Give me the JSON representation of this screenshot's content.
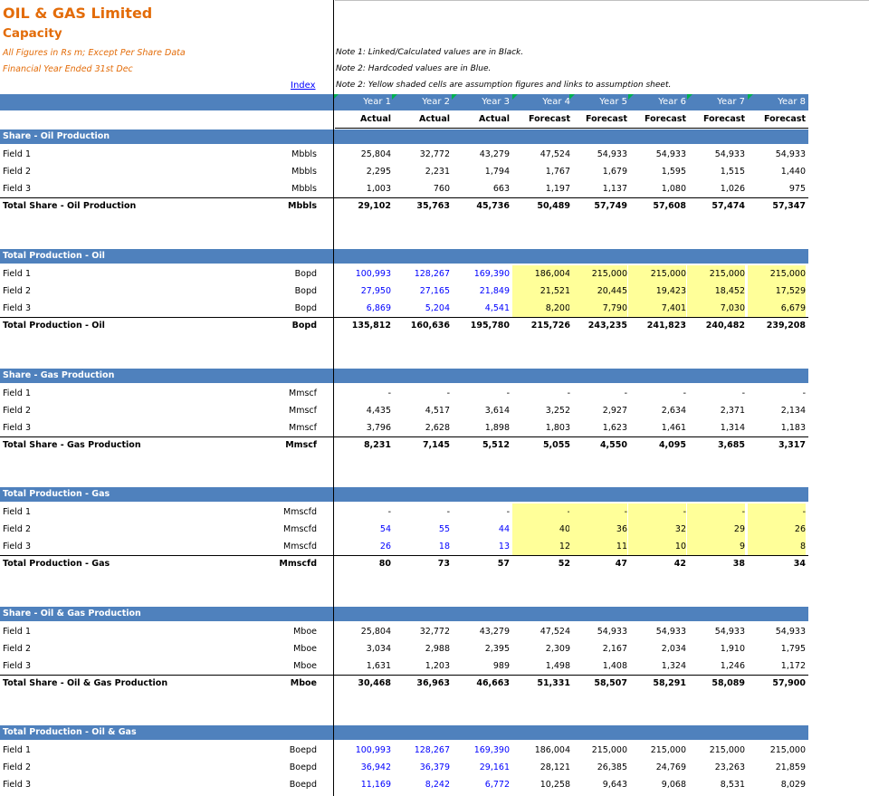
{
  "header": {
    "company": "OIL & GAS Limited",
    "sheet": "Capacity",
    "figures_note": "All Figures in Rs m; Except Per Share Data",
    "fy_note": "Financial Year Ended 31st Dec",
    "index_link": "Index",
    "note1": "Note 1: Linked/Calculated values are in Black.",
    "note2a": "Note 2: Hardcoded values are in Blue.",
    "note2b": "Note 2: Yellow shaded cells are assumption figures and links to assumption sheet.",
    "years": [
      "Year 1",
      "Year 2",
      "Year 3",
      "Year 4",
      "Year 5",
      "Year 6",
      "Year 7",
      "Year 8"
    ],
    "types": [
      "Actual",
      "Actual",
      "Actual",
      "Forecast",
      "Forecast",
      "Forecast",
      "Forecast",
      "Forecast"
    ]
  },
  "colors": {
    "band": "#4f81bd",
    "accent": "#e36c09",
    "input_blue": "#0000ff",
    "assumption_yellow": "#ffff99"
  },
  "sections": [
    {
      "title": "Share - Oil Production",
      "rows": [
        {
          "label": "Field 1",
          "unit": "Mbbls",
          "values": [
            "25,804",
            "32,772",
            "43,279",
            "47,524",
            "54,933",
            "54,933",
            "54,933",
            "54,933"
          ]
        },
        {
          "label": "Field 2",
          "unit": "Mbbls",
          "values": [
            "2,295",
            "2,231",
            "1,794",
            "1,767",
            "1,679",
            "1,595",
            "1,515",
            "1,440"
          ]
        },
        {
          "label": "Field 3",
          "unit": "Mbbls",
          "values": [
            "1,003",
            "760",
            "663",
            "1,197",
            "1,137",
            "1,080",
            "1,026",
            "975"
          ]
        }
      ],
      "total": {
        "label": "Total Share - Oil Production",
        "unit": "Mbbls",
        "values": [
          "29,102",
          "35,763",
          "45,736",
          "50,489",
          "57,749",
          "57,608",
          "57,474",
          "57,347"
        ]
      }
    },
    {
      "title": "Total Production - Oil",
      "rows": [
        {
          "label": "Field 1",
          "unit": "Bopd",
          "values": [
            "100,993",
            "128,267",
            "169,390",
            "186,004",
            "215,000",
            "215,000",
            "215,000",
            "215,000"
          ]
        },
        {
          "label": "Field 2",
          "unit": "Bopd",
          "values": [
            "27,950",
            "27,165",
            "21,849",
            "21,521",
            "20,445",
            "19,423",
            "18,452",
            "17,529"
          ]
        },
        {
          "label": "Field 3",
          "unit": "Bopd",
          "values": [
            "6,869",
            "5,204",
            "4,541",
            "8,200",
            "7,790",
            "7,401",
            "7,030",
            "6,679"
          ]
        }
      ],
      "total": {
        "label": "Total Production - Oil",
        "unit": "Bopd",
        "values": [
          "135,812",
          "160,636",
          "195,780",
          "215,726",
          "243,235",
          "241,823",
          "240,482",
          "239,208"
        ]
      }
    },
    {
      "title": "Share - Gas Production",
      "rows": [
        {
          "label": "Field 1",
          "unit": "Mmscf",
          "values": [
            "-",
            "-",
            "-",
            "-",
            "-",
            "-",
            "-",
            "-"
          ]
        },
        {
          "label": "Field 2",
          "unit": "Mmscf",
          "values": [
            "4,435",
            "4,517",
            "3,614",
            "3,252",
            "2,927",
            "2,634",
            "2,371",
            "2,134"
          ]
        },
        {
          "label": "Field 3",
          "unit": "Mmscf",
          "values": [
            "3,796",
            "2,628",
            "1,898",
            "1,803",
            "1,623",
            "1,461",
            "1,314",
            "1,183"
          ]
        }
      ],
      "total": {
        "label": "Total Share - Gas Production",
        "unit": "Mmscf",
        "values": [
          "8,231",
          "7,145",
          "5,512",
          "5,055",
          "4,550",
          "4,095",
          "3,685",
          "3,317"
        ]
      }
    },
    {
      "title": "Total Production - Gas",
      "rows": [
        {
          "label": "Field 1",
          "unit": "Mmscfd",
          "values": [
            "-",
            "-",
            "-",
            "-",
            "-",
            "-",
            "-",
            "-"
          ]
        },
        {
          "label": "Field 2",
          "unit": "Mmscfd",
          "values": [
            "54",
            "55",
            "44",
            "40",
            "36",
            "32",
            "29",
            "26"
          ]
        },
        {
          "label": "Field 3",
          "unit": "Mmscfd",
          "values": [
            "26",
            "18",
            "13",
            "12",
            "11",
            "10",
            "9",
            "8"
          ]
        }
      ],
      "total": {
        "label": "Total Production - Gas",
        "unit": "Mmscfd",
        "values": [
          "80",
          "73",
          "57",
          "52",
          "47",
          "42",
          "38",
          "34"
        ]
      }
    },
    {
      "title": "Share - Oil & Gas Production",
      "rows": [
        {
          "label": "Field 1",
          "unit": "Mboe",
          "values": [
            "25,804",
            "32,772",
            "43,279",
            "47,524",
            "54,933",
            "54,933",
            "54,933",
            "54,933"
          ]
        },
        {
          "label": "Field 2",
          "unit": "Mboe",
          "values": [
            "3,034",
            "2,988",
            "2,395",
            "2,309",
            "2,167",
            "2,034",
            "1,910",
            "1,795"
          ]
        },
        {
          "label": "Field 3",
          "unit": "Mboe",
          "values": [
            "1,631",
            "1,203",
            "989",
            "1,498",
            "1,408",
            "1,324",
            "1,246",
            "1,172"
          ]
        }
      ],
      "total": {
        "label": "Total Share - Oil & Gas Production",
        "unit": "Mboe",
        "values": [
          "30,468",
          "36,963",
          "46,663",
          "51,331",
          "58,507",
          "58,291",
          "58,089",
          "57,900"
        ]
      }
    },
    {
      "title": "Total Production - Oil & Gas",
      "rows": [
        {
          "label": "Field 1",
          "unit": "Boepd",
          "values": [
            "100,993",
            "128,267",
            "169,390",
            "186,004",
            "215,000",
            "215,000",
            "215,000",
            "215,000"
          ]
        },
        {
          "label": "Field 2",
          "unit": "Boepd",
          "values": [
            "36,942",
            "36,379",
            "29,161",
            "28,121",
            "26,385",
            "24,769",
            "23,263",
            "21,859"
          ]
        },
        {
          "label": "Field 3",
          "unit": "Boepd",
          "values": [
            "11,169",
            "8,242",
            "6,772",
            "10,258",
            "9,643",
            "9,068",
            "8,531",
            "8,029"
          ]
        }
      ],
      "total": null
    }
  ]
}
